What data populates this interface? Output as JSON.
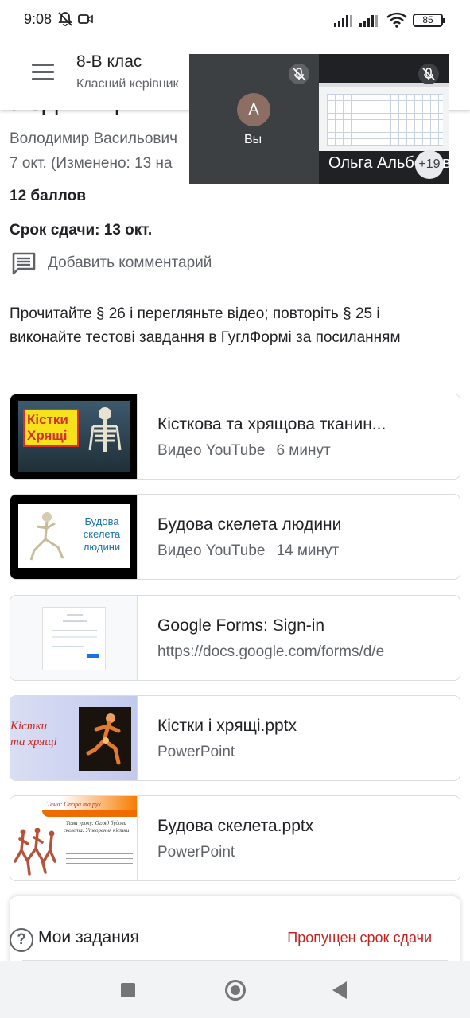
{
  "status_bar": {
    "time": "9:08",
    "battery": "85"
  },
  "header": {
    "class_title": "8-В клас",
    "class_subtitle": "Класний керівник"
  },
  "meet": {
    "self_initial": "А",
    "self_label": "Вы",
    "other_name": "Ольга Альбертівна",
    "more_count": "+19"
  },
  "assignment": {
    "partial_title": "з одиниця к",
    "teacher": "Володимир Васильович",
    "date": "7 окт. (Изменено: 13 на",
    "points": "12 баллов",
    "due": "Срок сдачи: 13 окт.",
    "add_comment": "Добавить комментарий",
    "instructions": "Прочитайте § 26 і перегляньте відео; повторіть § 25 і виконайте тестові завдання в ГуглФормі за посиланням"
  },
  "attachments": [
    {
      "title": "Кісткова та хрящова тканин...",
      "type": "Видео YouTube",
      "duration": "6 минут",
      "thumb_text": [
        "Кістки",
        "Хрящі"
      ]
    },
    {
      "title": "Будова скелета людини",
      "type": "Видео YouTube",
      "duration": "14 минут",
      "thumb_text": "Будова скелета людини"
    },
    {
      "title": "Google Forms: Sign-in",
      "type": "https://docs.google.com/forms/d/e",
      "duration": ""
    },
    {
      "title": "Кістки і хрящі.pptx",
      "type": "PowerPoint",
      "duration": "",
      "thumb_text": [
        "Кістки",
        "та хрящі"
      ]
    },
    {
      "title": "Будова скелета.pptx",
      "type": "PowerPoint",
      "duration": "",
      "thumb_text": [
        "Тема: Опора та рух",
        "Тема уроку: Огляд будови скелета. Утворення кістки"
      ]
    }
  ],
  "bottom_card": {
    "my_tasks": "Мои задания",
    "status": "Пропущен срок сдачи"
  },
  "colors": {
    "accent_missed": "#c5221f",
    "text_primary": "#202124",
    "text_secondary": "#5f6368"
  }
}
